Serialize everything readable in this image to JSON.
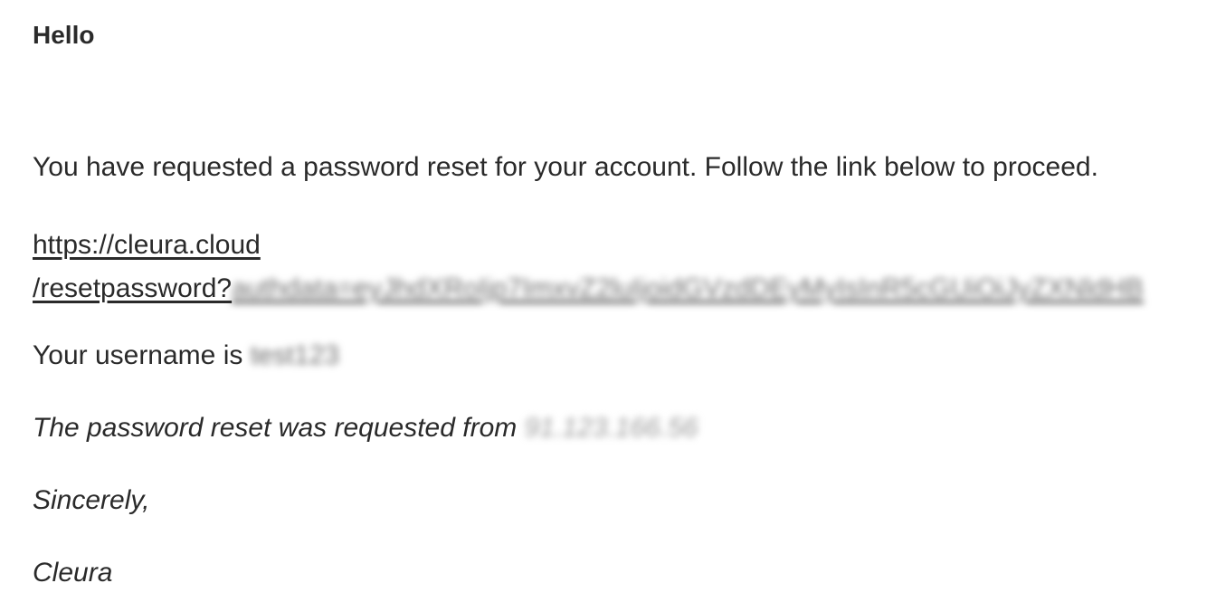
{
  "email": {
    "greeting": "Hello",
    "intro": "You have requested a password reset for your account. Follow the link below to proceed.",
    "reset_link": {
      "line1": "https://cleura.cloud",
      "line2_prefix": "/resetpassword?",
      "line2_redacted": "authdata=eyJhdXRoIjp7ImxvZ2luIjoidGVzdDEyMyIsInR5cGUiOiJyZXNldHB"
    },
    "username_prefix": "Your username is ",
    "username_redacted": "test123",
    "ip_prefix": "The password reset was requested from ",
    "ip_redacted": "91.123.166.56",
    "closing": "Sincerely,",
    "signature": "Cleura"
  }
}
